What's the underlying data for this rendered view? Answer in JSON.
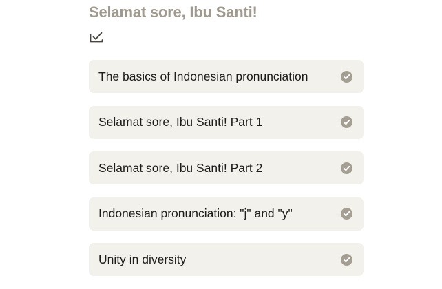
{
  "header": {
    "title": "Selamat sore, Ibu Santi!",
    "download_icon": "download-check-icon"
  },
  "lessons": [
    {
      "label": "The basics of Indonesian pronunciation",
      "completed": true
    },
    {
      "label": "Selamat sore, Ibu Santi! Part 1",
      "completed": true
    },
    {
      "label": "Selamat sore, Ibu Santi! Part 2",
      "completed": true
    },
    {
      "label": "Indonesian pronunciation: \"j\" and \"y\"",
      "completed": true
    },
    {
      "label": "Unity in diversity",
      "completed": true
    }
  ],
  "colors": {
    "title": "#a09a8e",
    "card_background": "#f3f1ec",
    "check_circle": "#a59f93",
    "text": "#1e1c1a"
  }
}
